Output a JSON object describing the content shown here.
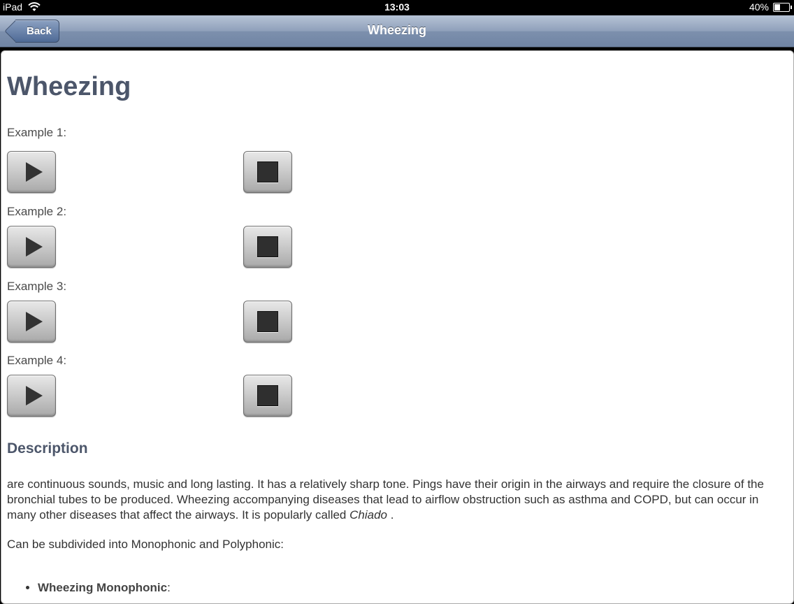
{
  "status_bar": {
    "device": "iPad",
    "time": "13:03",
    "battery": "40%",
    "battery_level": 0.4
  },
  "nav": {
    "back_label": "Back",
    "title": "Wheezing"
  },
  "content": {
    "heading": "Wheezing",
    "examples": [
      {
        "label": "Example 1:"
      },
      {
        "label": "Example 2:"
      },
      {
        "label": "Example 3:"
      },
      {
        "label": "Example 4:"
      }
    ],
    "description_heading": "Description",
    "description_text": "are continuous sounds, music and long lasting. It has a relatively sharp tone. Pings have their origin in the airways and require the closure of the bronchial tubes to be produced. Wheezing accompanying diseases that lead to airflow obstruction such as asthma and COPD, but can occur in many other diseases that affect the airways. It is popularly called",
    "description_italic": "Chiado",
    "description_end": " .",
    "subdivision_text": "Can be subdivided into Monophonic and Polyphonic:",
    "list_items": [
      {
        "bold": "Wheezing Monophonic",
        "suffix": ":"
      }
    ]
  },
  "icons": {
    "play": "play-icon",
    "stop": "stop-icon",
    "wifi": "wifi-icon",
    "battery": "battery-icon",
    "back": "back-arrow"
  }
}
